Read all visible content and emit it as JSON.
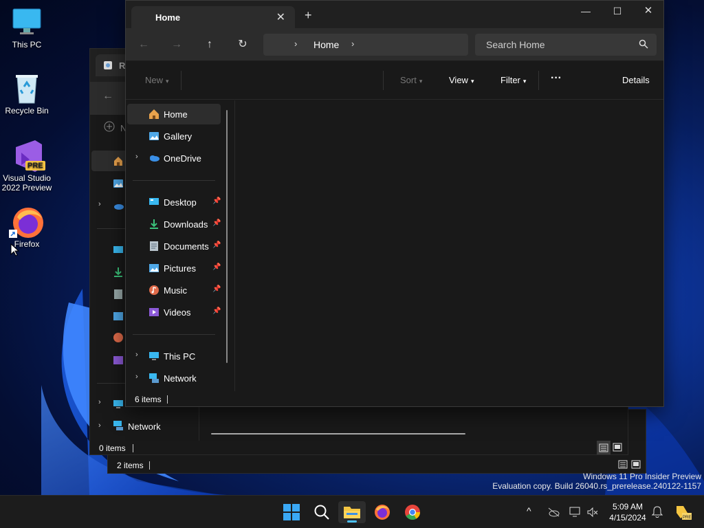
{
  "desktop": {
    "icons": [
      {
        "label": "This PC"
      },
      {
        "label": "Recycle Bin"
      },
      {
        "label": "Visual Studio 2022 Preview",
        "badge": "PRE"
      },
      {
        "label": "Firefox"
      }
    ]
  },
  "back_window_1": {
    "title_initial": "R",
    "nav_label": "Network",
    "status": "0 items"
  },
  "back_window_2": {
    "status": "2 items"
  },
  "main_window": {
    "tab_title": "Home",
    "tab_close": "✕",
    "new_tab": "+",
    "controls": {
      "minimize": "—",
      "maximize": "☐",
      "close": "✕"
    },
    "nav": {
      "back": "←",
      "forward": "→",
      "up": "↑",
      "refresh": "↻"
    },
    "address": {
      "crumb": "Home",
      "chevron": "›"
    },
    "search": {
      "placeholder": "Search Home"
    },
    "commands": {
      "new": "New",
      "sort": "Sort",
      "view": "View",
      "filter": "Filter",
      "more": "···",
      "details": "Details"
    },
    "nav_pane": {
      "top": [
        {
          "label": "Home",
          "icon": "home-icon"
        },
        {
          "label": "Gallery",
          "icon": "gallery-icon"
        },
        {
          "label": "OneDrive",
          "icon": "onedrive-icon"
        }
      ],
      "pinned": [
        {
          "label": "Desktop",
          "icon": "desktop-icon"
        },
        {
          "label": "Downloads",
          "icon": "downloads-icon"
        },
        {
          "label": "Documents",
          "icon": "documents-icon"
        },
        {
          "label": "Pictures",
          "icon": "pictures-icon"
        },
        {
          "label": "Music",
          "icon": "music-icon"
        },
        {
          "label": "Videos",
          "icon": "videos-icon"
        }
      ],
      "drives": [
        {
          "label": "This PC",
          "icon": "this-pc-icon"
        },
        {
          "label": "Network",
          "icon": "network-icon"
        }
      ]
    },
    "status": "6 items"
  },
  "watermark": {
    "line1": "Windows 11 Pro Insider Preview",
    "line2": "Evaluation copy. Build 26040.rs_prerelease.240122-1157"
  },
  "taskbar": {
    "clock_time": "5:09 AM",
    "clock_date": "4/15/2024",
    "tray_chevron": "^"
  },
  "colors": {
    "accent": "#4cc2ff",
    "window_bg": "#191919",
    "toolbar_bg": "#2c2c2c"
  }
}
